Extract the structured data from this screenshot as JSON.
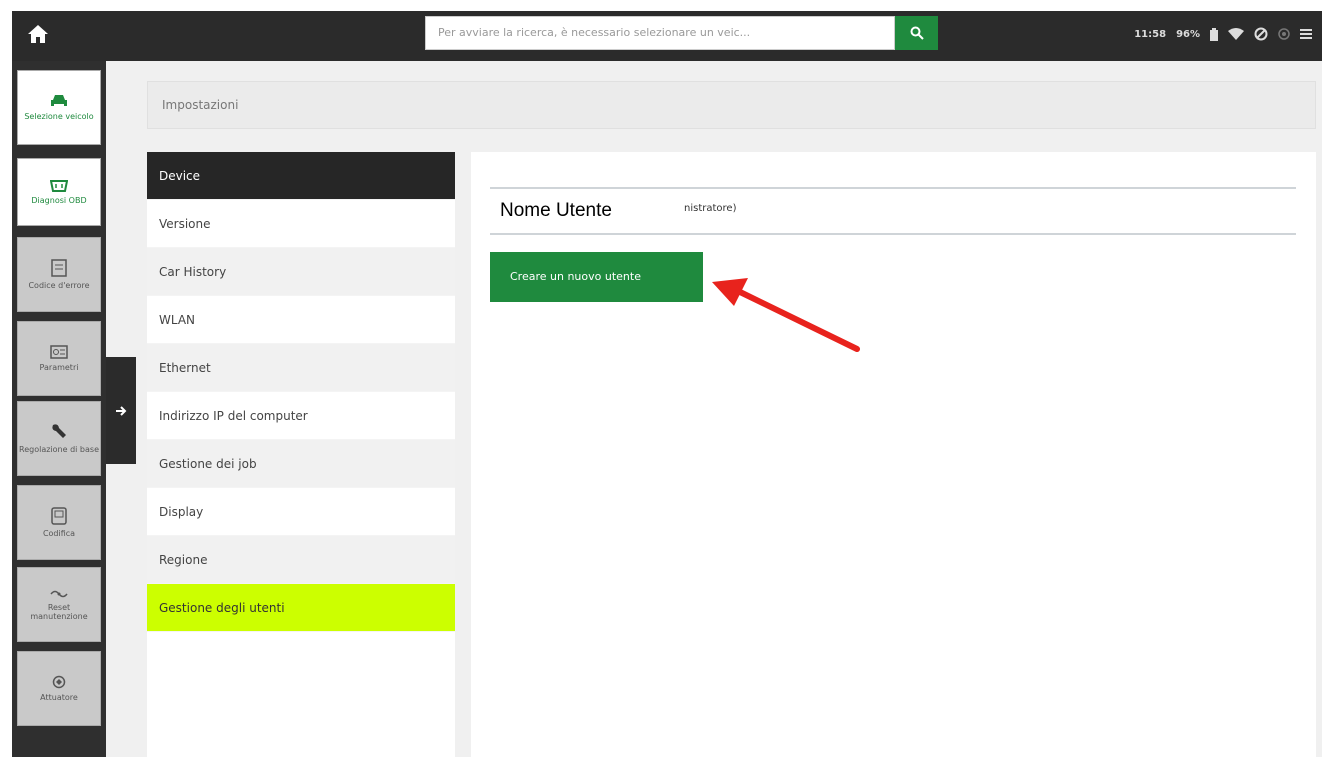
{
  "topbar": {
    "search_placeholder": "Per avviare la ricerca, è necessario selezionare un veic...",
    "time": "11:58",
    "battery": "96%"
  },
  "rail": {
    "items": [
      {
        "label": "Selezione veicolo",
        "icon": "car-icon"
      },
      {
        "label": "Diagnosi OBD",
        "icon": "obd-icon"
      },
      {
        "label": "Codice d'errore",
        "icon": "error-code-icon"
      },
      {
        "label": "Parametri",
        "icon": "parameters-icon"
      },
      {
        "label": "Regolazione di base",
        "icon": "wrench-icon"
      },
      {
        "label": "Codifica",
        "icon": "coding-icon"
      },
      {
        "label": "Reset manutenzione",
        "icon": "maintenance-reset-icon"
      },
      {
        "label": "Attuatore",
        "icon": "actuator-icon"
      }
    ]
  },
  "breadcrumb": "Impostazioni",
  "menu": {
    "items": [
      {
        "label": "Device"
      },
      {
        "label": "Versione"
      },
      {
        "label": "Car History"
      },
      {
        "label": "WLAN"
      },
      {
        "label": "Ethernet"
      },
      {
        "label": "Indirizzo IP del computer"
      },
      {
        "label": "Gestione dei job"
      },
      {
        "label": "Display"
      },
      {
        "label": "Regione"
      },
      {
        "label": "Gestione degli utenti"
      }
    ]
  },
  "panel": {
    "username_label": "Nome Utente",
    "user_role_partial": "nistratore)",
    "create_button": "Creare un nuovo utente"
  },
  "colors": {
    "accent": "#1f8a3e",
    "selected": "#ccff00",
    "arrow": "#e8231d"
  }
}
